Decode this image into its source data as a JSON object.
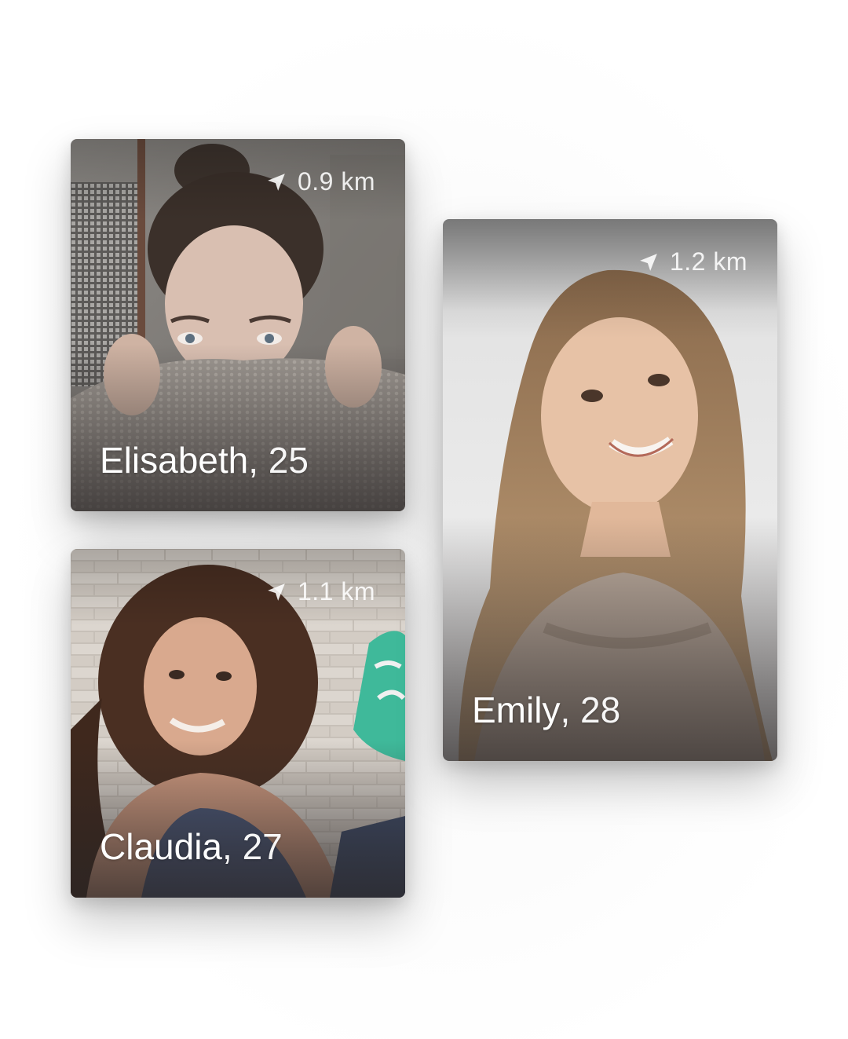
{
  "cards": [
    {
      "name": "Elisabeth",
      "separator": ",",
      "age": "25",
      "distance": "0.9 km",
      "distance_icon": "navigation-arrow-icon"
    },
    {
      "name": "Claudia",
      "separator": ",",
      "age": "27",
      "distance": "1.1 km",
      "distance_icon": "navigation-arrow-icon"
    },
    {
      "name": "Emily",
      "separator": ",",
      "age": "28",
      "distance": "1.2 km",
      "distance_icon": "navigation-arrow-icon"
    }
  ],
  "colors": {
    "background": "#ffffff",
    "caption_text": "#ffffff",
    "overlay": "#282424"
  }
}
